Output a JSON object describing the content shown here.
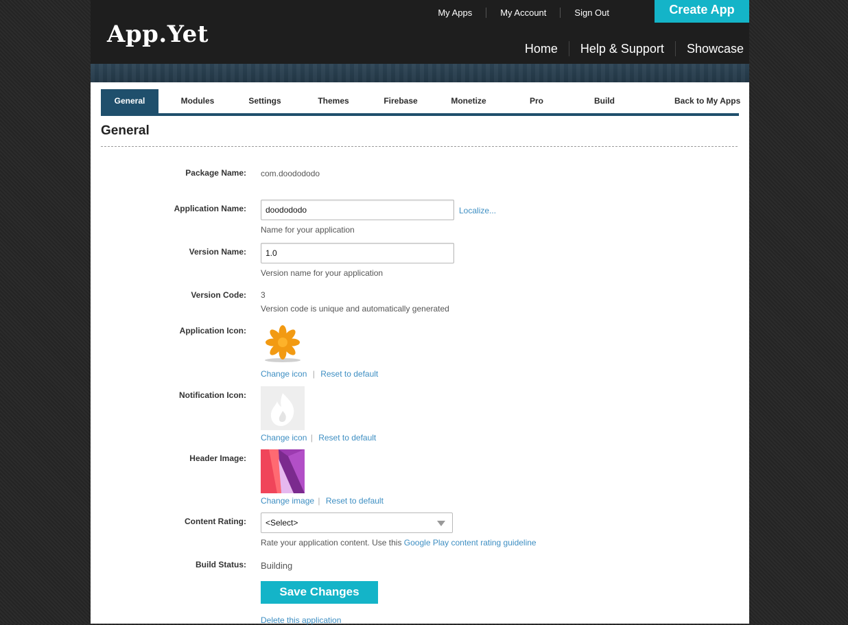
{
  "header": {
    "logo": "App.Yet",
    "top_links": [
      "My Apps",
      "My Account",
      "Sign Out"
    ],
    "create_button": "Create App",
    "main_nav": [
      "Home",
      "Help & Support",
      "Showcase"
    ]
  },
  "tabs": [
    "General",
    "Modules",
    "Settings",
    "Themes",
    "Firebase",
    "Monetize",
    "Pro",
    "Build",
    "Back to My Apps"
  ],
  "active_tab": "General",
  "section_title": "General",
  "form": {
    "package_name_label": "Package Name:",
    "package_name": "com.doodododo",
    "app_name_label": "Application Name:",
    "app_name": "doodododo",
    "localize_link": "Localize...",
    "app_name_help": "Name for your application",
    "version_name_label": "Version Name:",
    "version_name": "1.0",
    "version_name_help": "Version name for your application",
    "version_code_label": "Version Code:",
    "version_code": "3",
    "version_code_help": "Version code is unique and automatically generated",
    "app_icon_label": "Application Icon:",
    "change_icon": "Change icon",
    "reset_default": "Reset to default",
    "notif_icon_label": "Notification Icon:",
    "header_image_label": "Header Image:",
    "change_image": "Change image",
    "content_rating_label": "Content Rating:",
    "content_rating_value": "<Select>",
    "content_rating_help": "Rate your application content. Use this",
    "content_rating_link": "Google Play content rating guideline",
    "build_status_label": "Build Status:",
    "build_status": "Building",
    "pipe": "|",
    "save_button": "Save Changes",
    "delete_link": "Delete this application"
  },
  "colors": {
    "accent": "#14b4c8",
    "tab_active": "#1f4f6c",
    "link": "#3d8ec2",
    "topbar": "#1e1e1e"
  }
}
